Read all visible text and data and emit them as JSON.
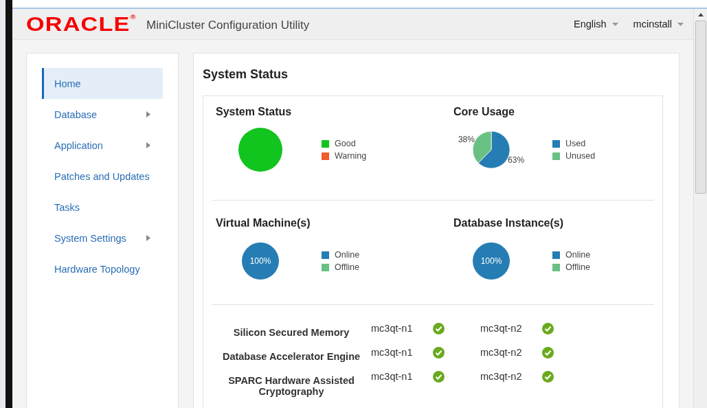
{
  "header": {
    "logo": "ORACLE$^{®}$",
    "app_title": "MiniCluster Configuration Utility",
    "menus": [
      {
        "label": "English"
      },
      {
        "label": "mcinstall"
      }
    ]
  },
  "sidebar": {
    "items": [
      {
        "label": "Home",
        "selected": true,
        "has_submenu": false
      },
      {
        "label": "Database",
        "selected": false,
        "has_submenu": true
      },
      {
        "label": "Application",
        "selected": false,
        "has_submenu": true
      },
      {
        "label": "Patches and Updates",
        "selected": false,
        "has_submenu": false
      },
      {
        "label": "Tasks",
        "selected": false,
        "has_submenu": false
      },
      {
        "label": "System Settings",
        "selected": false,
        "has_submenu": true
      },
      {
        "label": "Hardware Topology",
        "selected": false,
        "has_submenu": false
      }
    ]
  },
  "main": {
    "title": "System Status",
    "panels": [
      {
        "title": "System Status",
        "legend": [
          {
            "color": "#11c41e"
          },
          {
            "color": "#f25c2a"
          }
        ],
        "chart_data": {
          "type": "pie",
          "categories": [
            "Good",
            "Warning"
          ],
          "values": [
            100,
            0
          ]
        }
      },
      {
        "title": "Core Usage",
        "legend": [
          {
            "color": "#267db3"
          },
          {
            "color": "#68c182"
          }
        ],
        "chart_data": {
          "type": "pie",
          "categories": [
            "Used",
            "Unused"
          ],
          "values": [
            63,
            38
          ],
          "value_labels": [
            "63%",
            "38%"
          ]
        }
      },
      {
        "title": "Virtual Machine(s)",
        "legend": [
          {
            "color": "#267db3"
          },
          {
            "color": "#68c182"
          }
        ],
        "chart_data": {
          "type": "pie",
          "categories": [
            "Online",
            "Offline"
          ],
          "values": [
            100,
            0
          ],
          "value_labels": [
            "100%",
            null
          ]
        }
      },
      {
        "title": "Database Instance(s)",
        "legend": [
          {
            "color": "#267db3"
          },
          {
            "color": "#68c182"
          }
        ],
        "chart_data": {
          "type": "pie",
          "categories": [
            "Online",
            "Offline"
          ],
          "values": [
            100,
            0
          ],
          "value_labels": [
            "100%",
            null
          ]
        }
      }
    ],
    "features": [
      {
        "label": "Silicon Secured Memory",
        "nodes": [
          {
            "name": "mc3qt-n1",
            "ok": true
          },
          {
            "name": "mc3qt-n2",
            "ok": true
          }
        ]
      },
      {
        "label": "Database Accelerator Engine",
        "nodes": [
          {
            "name": "mc3qt-n1",
            "ok": true
          },
          {
            "name": "mc3qt-n2",
            "ok": true
          }
        ]
      },
      {
        "label": "SPARC Hardware Assisted Cryptography",
        "nodes": [
          {
            "name": "mc3qt-n1",
            "ok": true
          },
          {
            "name": "mc3qt-n2",
            "ok": true
          }
        ]
      }
    ]
  }
}
